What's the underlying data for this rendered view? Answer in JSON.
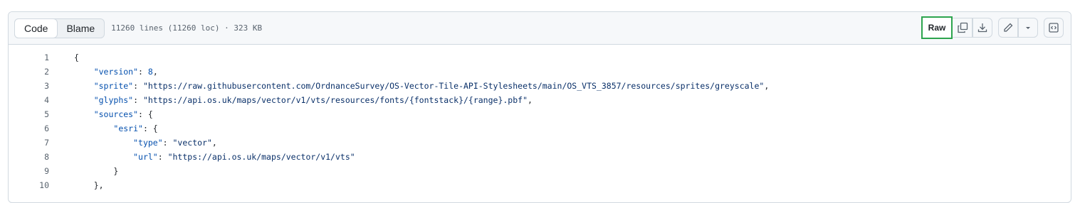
{
  "header": {
    "tabs": [
      {
        "label": "Code",
        "active": true
      },
      {
        "label": "Blame",
        "active": false
      }
    ],
    "file_info": "11260 lines (11260 loc) · 323 KB",
    "raw_label": "Raw",
    "icons": [
      "copy-raw-icon",
      "download-icon",
      "pencil-icon",
      "triangle-down-icon",
      "symbols-panel-icon"
    ]
  },
  "code": {
    "lines": [
      {
        "num": "1",
        "indent": "",
        "parts": [
          {
            "t": "p",
            "v": "{"
          }
        ]
      },
      {
        "num": "2",
        "indent": "    ",
        "parts": [
          {
            "t": "k",
            "v": "\"version\""
          },
          {
            "t": "p",
            "v": ": "
          },
          {
            "t": "n",
            "v": "8"
          },
          {
            "t": "p",
            "v": ","
          }
        ]
      },
      {
        "num": "3",
        "indent": "    ",
        "parts": [
          {
            "t": "k",
            "v": "\"sprite\""
          },
          {
            "t": "p",
            "v": ": "
          },
          {
            "t": "s",
            "v": "\"https://raw.githubusercontent.com/OrdnanceSurvey/OS-Vector-Tile-API-Stylesheets/main/OS_VTS_3857/resources/sprites/greyscale\""
          },
          {
            "t": "p",
            "v": ","
          }
        ]
      },
      {
        "num": "4",
        "indent": "    ",
        "parts": [
          {
            "t": "k",
            "v": "\"glyphs\""
          },
          {
            "t": "p",
            "v": ": "
          },
          {
            "t": "s",
            "v": "\"https://api.os.uk/maps/vector/v1/vts/resources/fonts/{fontstack}/{range}.pbf\""
          },
          {
            "t": "p",
            "v": ","
          }
        ]
      },
      {
        "num": "5",
        "indent": "    ",
        "parts": [
          {
            "t": "k",
            "v": "\"sources\""
          },
          {
            "t": "p",
            "v": ": {"
          }
        ]
      },
      {
        "num": "6",
        "indent": "        ",
        "parts": [
          {
            "t": "k",
            "v": "\"esri\""
          },
          {
            "t": "p",
            "v": ": {"
          }
        ]
      },
      {
        "num": "7",
        "indent": "            ",
        "parts": [
          {
            "t": "k",
            "v": "\"type\""
          },
          {
            "t": "p",
            "v": ": "
          },
          {
            "t": "s",
            "v": "\"vector\""
          },
          {
            "t": "p",
            "v": ","
          }
        ]
      },
      {
        "num": "8",
        "indent": "            ",
        "parts": [
          {
            "t": "k",
            "v": "\"url\""
          },
          {
            "t": "p",
            "v": ": "
          },
          {
            "t": "s",
            "v": "\"https://api.os.uk/maps/vector/v1/vts\""
          }
        ]
      },
      {
        "num": "9",
        "indent": "        ",
        "parts": [
          {
            "t": "p",
            "v": "}"
          }
        ]
      },
      {
        "num": "10",
        "indent": "    ",
        "parts": [
          {
            "t": "p",
            "v": "},"
          }
        ]
      }
    ]
  },
  "colors": {
    "raw_highlight": "#2da44e",
    "key": "#0550ae",
    "string": "#0a3069",
    "line_number": "#59636e"
  }
}
